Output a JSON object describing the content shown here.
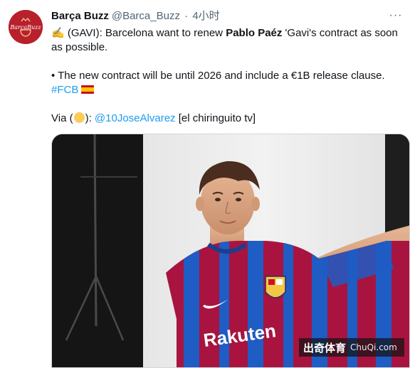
{
  "tweet": {
    "display_name": "Barça Buzz",
    "handle": "@Barca_Buzz",
    "separator": "·",
    "time": "4小时",
    "avatar_text": "BarçaBuzz",
    "more_label": "···",
    "line1_prefix": "(GAVI): Barcelona want to renew ",
    "line1_bold": "Pablo Paéz",
    "line1_suffix": " 'Gavi's contract as soon as possible.",
    "line2": "• The new contract will be until 2026 and include a €1B release clause.",
    "hashtag": "#FCB",
    "via_prefix": "Via (",
    "via_mid": "): ",
    "via_link": "@10JoseAlvarez",
    "via_suffix": " [el chiringuito tv]",
    "emoji_write": "✍️"
  },
  "media": {
    "jersey_sponsor": "Rakuten"
  },
  "watermark": {
    "cn": "出奇体育",
    "en": "ChuQi.com"
  },
  "colors": {
    "link": "#1d9bf0",
    "avatar_bg": "#b8202c",
    "jersey_blue": "#1f5cc4",
    "jersey_red": "#a8143f"
  }
}
